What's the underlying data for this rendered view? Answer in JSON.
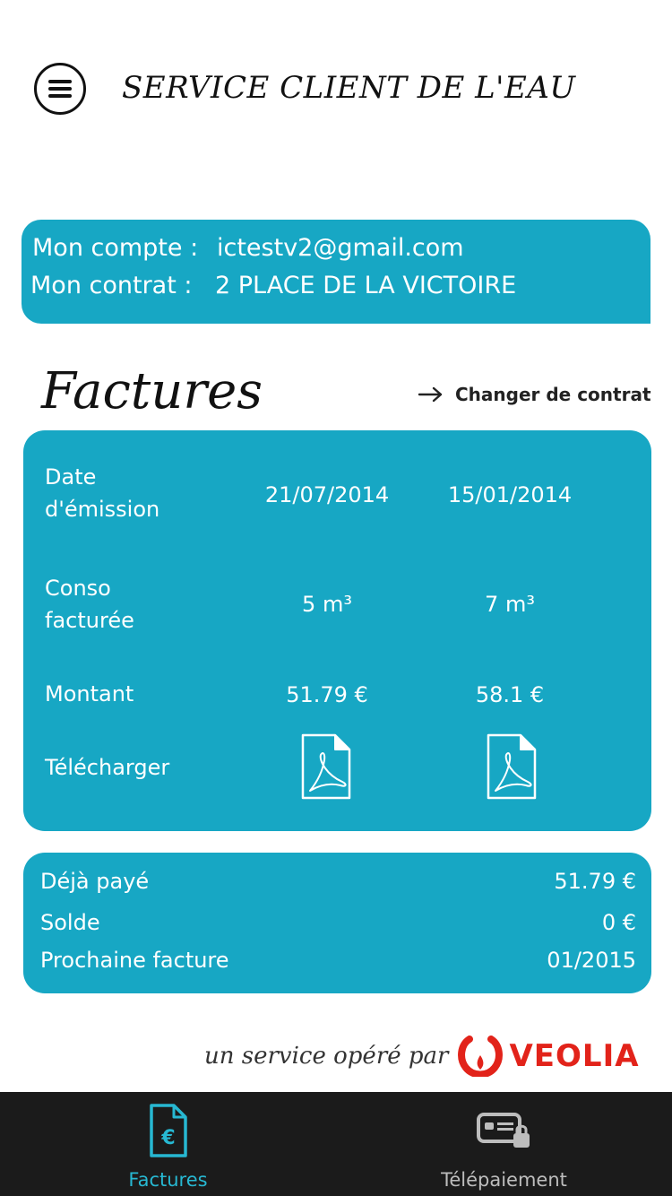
{
  "header": {
    "title": "SERVICE CLIENT DE L'EAU",
    "menu_icon": "hamburger-menu-icon"
  },
  "account": {
    "account_label": "Mon compte :",
    "account_value": "ictestv2@gmail.com",
    "contract_label": "Mon contrat  :",
    "contract_value": "2 PLACE DE LA VICTOIRE"
  },
  "invoices": {
    "title": "Factures",
    "change_contract": "Changer de contrat",
    "labels": {
      "date": "Date d'émission",
      "conso": "Conso facturée",
      "amount": "Montant",
      "download": "Télécharger"
    },
    "columns": [
      {
        "date": "21/07/2014",
        "conso": "5 m³",
        "amount": "51.79 €"
      },
      {
        "date": "15/01/2014",
        "conso": "7 m³",
        "amount": "58.1 €"
      }
    ]
  },
  "summary": {
    "paid_label": "Déjà payé",
    "paid_value": "51.79 €",
    "balance_label": "Solde",
    "balance_value": "0 €",
    "next_label": "Prochaine facture",
    "next_value": "01/2015"
  },
  "footer": {
    "operated_by": "un service opéré par",
    "brand": "VEOLIA"
  },
  "tabs": [
    {
      "label": "Factures",
      "icon": "invoice-euro-icon",
      "active": true
    },
    {
      "label": "Télépaiement",
      "icon": "secure-card-icon",
      "active": false
    }
  ],
  "colors": {
    "accent": "#17a7c4",
    "active_tab": "#27b8d2",
    "inactive_tab": "#bdbdbd",
    "tabbar_bg": "#1b1b1b",
    "brand_red": "#e2231a"
  }
}
